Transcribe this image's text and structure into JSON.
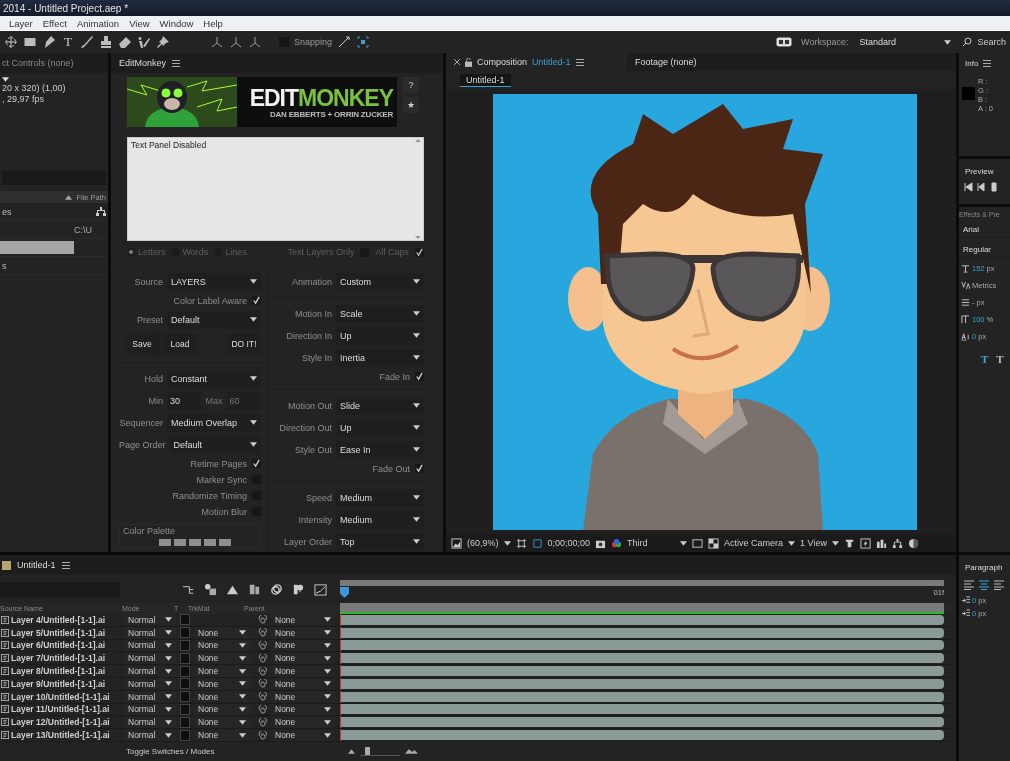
{
  "window": {
    "title": "2014 - Untitled Project.aep *"
  },
  "menu": [
    "Layer",
    "Effect",
    "Animation",
    "View",
    "Window",
    "Help"
  ],
  "toolbar": {
    "text_tool": "T",
    "snapping": {
      "label": "Snapping",
      "checked": false
    },
    "workspace": {
      "label": "Workspace:",
      "value": "Standard"
    },
    "search": "Search"
  },
  "project_panel": {
    "tab": "ct Controls (none)",
    "details": [
      "20 x 320) (1,00)",
      ", 29,97 fps"
    ],
    "column": "File Path",
    "items": [
      {
        "name": "es",
        "selected": false
      },
      {
        "path": "C:\\U",
        "selected": false
      },
      {
        "selected": true
      },
      {
        "name": "s",
        "selected": false
      }
    ]
  },
  "editmonkey": {
    "tab": "EditMonkey",
    "banner": {
      "word_a": "EDIT",
      "word_b": "MONKEY",
      "credit": "DAN EBBERTS + ORRIN ZUCKER"
    },
    "help": "?",
    "favorite": "★",
    "text_area": "Text Panel Disabled",
    "text_options": {
      "disabled": true,
      "split_modes": [
        {
          "label": "Letters",
          "selected": true
        },
        {
          "label": "Words",
          "selected": false
        },
        {
          "label": "Lines",
          "selected": false
        }
      ],
      "toggles": [
        {
          "label": "Text Layers Only",
          "checked": false
        },
        {
          "label": "All Caps",
          "checked": true
        }
      ]
    },
    "left": [
      {
        "kind": "dropdown",
        "label": "Source",
        "value": "LAYERS"
      },
      {
        "kind": "check",
        "label": "Color Label Aware",
        "checked": true
      },
      {
        "kind": "dropdown",
        "label": "Preset",
        "value": "Default"
      },
      {
        "kind": "buttons",
        "buttons": [
          "Save",
          "Load",
          "DO IT!"
        ]
      },
      {
        "kind": "divider"
      },
      {
        "kind": "dropdown",
        "label": "Hold",
        "value": "Constant"
      },
      {
        "kind": "range",
        "label": "Min",
        "value": "30",
        "max_label": "Max",
        "max_value": "60",
        "max_disabled": true
      },
      {
        "kind": "dropdown",
        "label": "Sequencer",
        "value": "Medium Overlap"
      },
      {
        "kind": "dropdown",
        "label": "Page Order",
        "value": "Default"
      },
      {
        "kind": "check",
        "label": "Retime Pages",
        "checked": true
      },
      {
        "kind": "check",
        "label": "Marker Sync",
        "checked": false
      },
      {
        "kind": "check",
        "label": "Randomize Timing",
        "checked": false
      },
      {
        "kind": "check",
        "label": "Motion Blur",
        "checked": false
      },
      {
        "kind": "palette",
        "label": "Color Palette",
        "swatches": [
          {
            "color": "#8e8e8e"
          },
          {
            "color": "#8e8e8e"
          },
          {
            "color": "#8e8e8e"
          },
          {
            "color": "#8e8e8e"
          },
          {
            "color": "#8e8e8e"
          }
        ]
      }
    ],
    "right": [
      {
        "kind": "dropdown",
        "label": "Animation",
        "value": "Custom"
      },
      {
        "kind": "divider"
      },
      {
        "kind": "dropdown",
        "label": "Motion In",
        "value": "Scale"
      },
      {
        "kind": "dropdown",
        "label": "Direction In",
        "value": "Up"
      },
      {
        "kind": "dropdown",
        "label": "Style In",
        "value": "Inertia"
      },
      {
        "kind": "check",
        "label": "Fade In",
        "checked": true
      },
      {
        "kind": "divider"
      },
      {
        "kind": "dropdown",
        "label": "Motion Out",
        "value": "Slide"
      },
      {
        "kind": "dropdown",
        "label": "Direction Out",
        "value": "Up"
      },
      {
        "kind": "dropdown",
        "label": "Style Out",
        "value": "Ease In"
      },
      {
        "kind": "check",
        "label": "Fade Out",
        "checked": true
      },
      {
        "kind": "divider"
      },
      {
        "kind": "dropdown",
        "label": "Speed",
        "value": "Medium"
      },
      {
        "kind": "dropdown",
        "label": "Intensity",
        "value": "Medium"
      },
      {
        "kind": "dropdown",
        "label": "Layer Order",
        "value": "Top"
      }
    ]
  },
  "composition": {
    "tabs": [
      {
        "label": "Composition",
        "target": "Untitled-1",
        "selected": true
      },
      {
        "label": "Footage (none)",
        "selected": false
      }
    ],
    "viewer_tab": "Untitled-1",
    "footer": {
      "zoom": "(60,9%)",
      "timecode": "0;00;00;00",
      "resolution": "Third",
      "camera": "Active Camera",
      "views": "1 View"
    }
  },
  "info": {
    "tab": "Info",
    "readouts": [
      "R :",
      "G :",
      "B :",
      "A : 0"
    ]
  },
  "preview": {
    "tab": "Preview"
  },
  "effects_presets": {
    "tab": "Effects & Pre"
  },
  "character": {
    "font": "Arial",
    "style": "Regular",
    "size": {
      "value": "152",
      "unit": "px"
    },
    "kerning": "Metrics",
    "leading": "- px",
    "vertical_scale": {
      "value": "100",
      "unit": "%"
    },
    "baseline_shift": {
      "value": "0",
      "unit": "px"
    },
    "style_buttons": [
      {
        "label": "T",
        "selected": true
      },
      {
        "label": "T",
        "selected": false
      }
    ]
  },
  "timeline": {
    "tab": "Untitled-1",
    "ruler_end": "01f",
    "zoom": {
      "level": 0.15
    },
    "columns": [
      "Source Name",
      "Mode",
      "T",
      "TrkMat",
      "Parent"
    ],
    "footer": "Toggle Switches / Modes",
    "layers": [
      {
        "name": "Layer 4/Untitled-[1-1].ai",
        "mode": "Normal",
        "parent": "None"
      },
      {
        "name": "Layer 5/Untitled-[1-1].ai",
        "mode": "Normal",
        "trkmat": "None",
        "parent": "None"
      },
      {
        "name": "Layer 6/Untitled-[1-1].ai",
        "mode": "Normal",
        "trkmat": "None",
        "parent": "None"
      },
      {
        "name": "Layer 7/Untitled-[1-1].ai",
        "mode": "Normal",
        "trkmat": "None",
        "parent": "None"
      },
      {
        "name": "Layer 8/Untitled-[1-1].ai",
        "mode": "Normal",
        "trkmat": "None",
        "parent": "None"
      },
      {
        "name": "Layer 9/Untitled-[1-1].ai",
        "mode": "Normal",
        "trkmat": "None",
        "parent": "None"
      },
      {
        "name": "Layer 10/Untitled-[1-1].ai",
        "mode": "Normal",
        "trkmat": "None",
        "parent": "None"
      },
      {
        "name": "Layer 11/Untitled-[1-1].ai",
        "mode": "Normal",
        "trkmat": "None",
        "parent": "None"
      },
      {
        "name": "Layer 12/Untitled-[1-1].ai",
        "mode": "Normal",
        "trkmat": "None",
        "parent": "None"
      },
      {
        "name": "Layer 13/Untitled-[1-1].ai",
        "mode": "Normal",
        "trkmat": "None",
        "parent": "None"
      }
    ]
  },
  "paragraph": {
    "tab": "Paragraph",
    "alignments": [
      {
        "selected": false
      },
      {
        "selected": true
      },
      {
        "selected": false
      }
    ],
    "indents": [
      {
        "value": "0",
        "unit": "px"
      },
      {
        "value": "0",
        "unit": "px"
      }
    ]
  }
}
